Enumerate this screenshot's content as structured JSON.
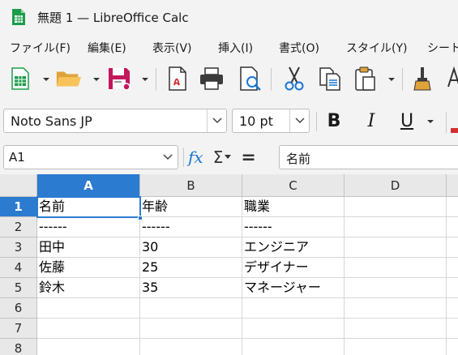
{
  "window": {
    "title": "無題 1 — LibreOffice Calc"
  },
  "menu": [
    "ファイル(F)",
    "編集(E)",
    "表示(V)",
    "挿入(I)",
    "書式(O)",
    "スタイル(Y)",
    "シート"
  ],
  "toolbar": {
    "icons": [
      "new-spreadsheet-icon",
      "open-folder-icon",
      "save-icon",
      "export-pdf-icon",
      "print-icon",
      "print-preview-icon",
      "cut-icon",
      "copy-icon",
      "paste-icon",
      "clone-formatting-icon",
      "font-color-icon"
    ]
  },
  "format": {
    "font_name": "Noto Sans JP",
    "font_size": "10 pt",
    "bold": "B",
    "italic": "I",
    "underline": "U"
  },
  "formula": {
    "name_box": "A1",
    "fx": "fx",
    "sum": "Σ",
    "equals": "=",
    "content": "名前"
  },
  "colors": {
    "selection": "#2b7bd1",
    "header_bg": "#e8e8e8"
  },
  "sheet": {
    "columns": [
      "A",
      "B",
      "C",
      "D"
    ],
    "rows": [
      "1",
      "2",
      "3",
      "4",
      "5",
      "6",
      "7",
      "8"
    ],
    "cells": [
      [
        "名前",
        "年齢",
        "職業",
        ""
      ],
      [
        "------",
        "------",
        "------",
        ""
      ],
      [
        "田中",
        "30",
        "エンジニア",
        ""
      ],
      [
        "佐藤",
        "25",
        "デザイナー",
        ""
      ],
      [
        "鈴木",
        "35",
        "マネージャー",
        ""
      ],
      [
        "",
        "",
        "",
        ""
      ],
      [
        "",
        "",
        "",
        ""
      ],
      [
        "",
        "",
        "",
        ""
      ]
    ],
    "selected_cell": "A1"
  }
}
